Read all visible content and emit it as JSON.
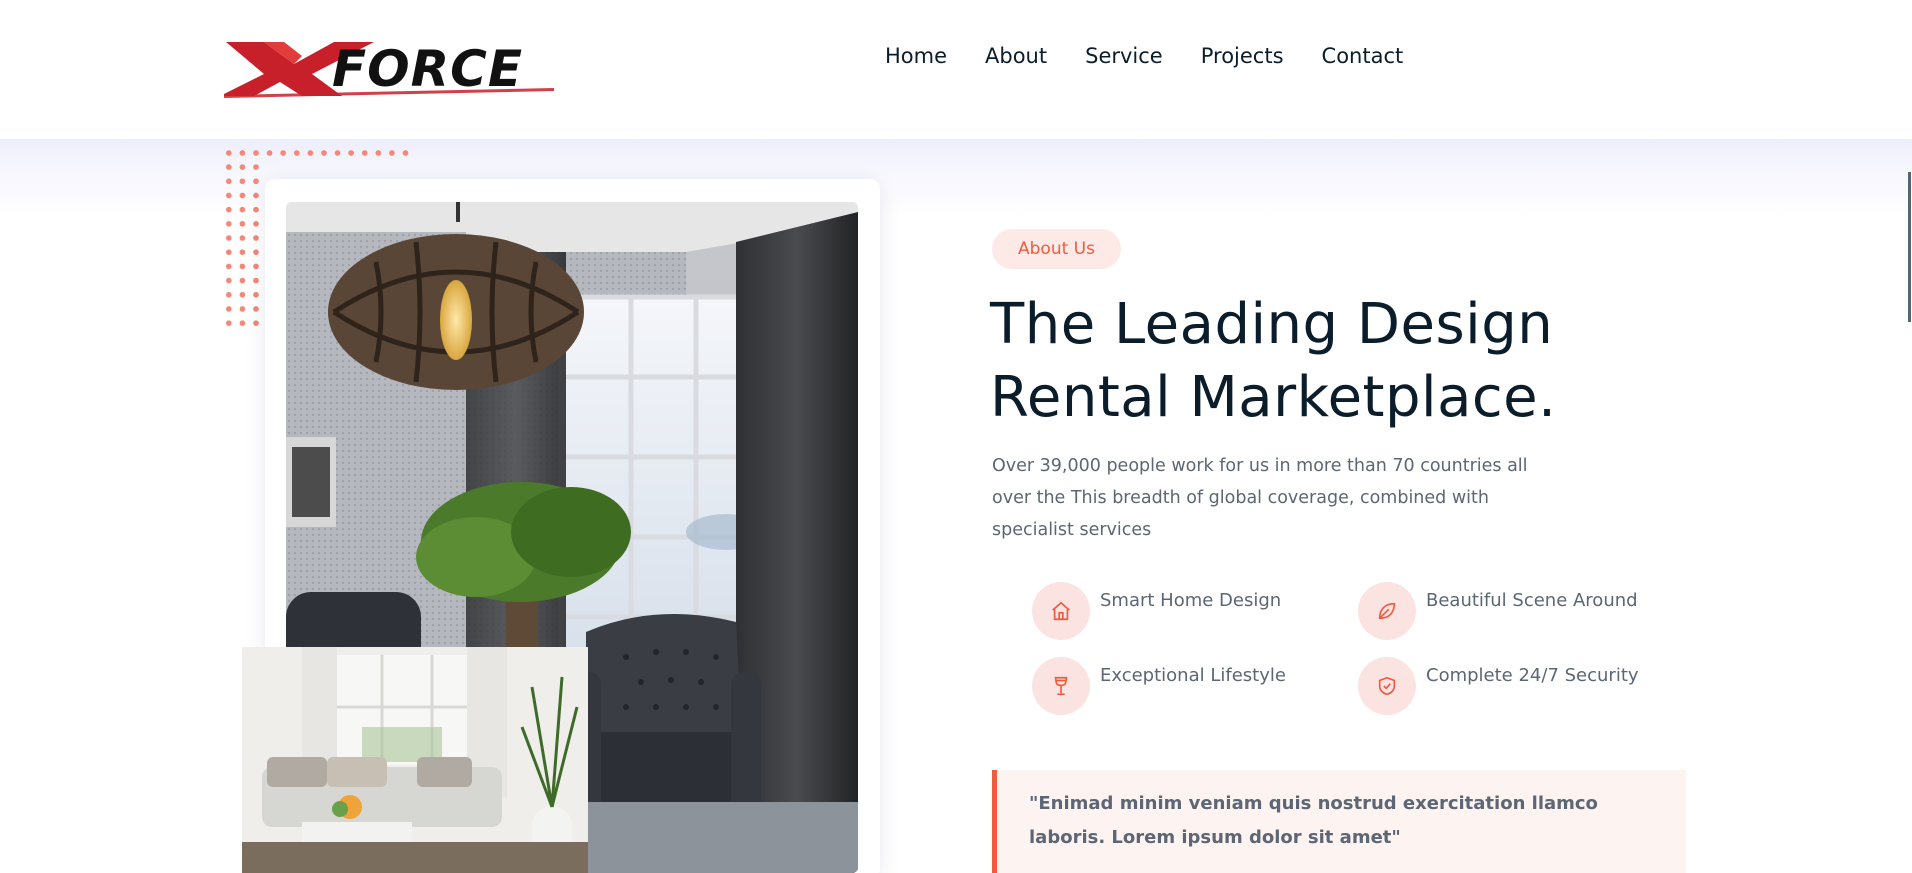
{
  "brand": {
    "logo_text_x": "X",
    "logo_text_force": "FORCE",
    "accent": "#f15a3f",
    "logo_red": "#c8202a",
    "dark": "#0b1d2a"
  },
  "nav": {
    "items": [
      "Home",
      "About",
      "Service",
      "Projects",
      "Contact"
    ]
  },
  "about": {
    "badge": "About Us",
    "title_line1": "The Leading Design",
    "title_line2": "Rental Marketplace.",
    "description": "Over 39,000 people work for us in more than 70 countries all over the This breadth of global coverage, combined with specialist services",
    "features": [
      {
        "label": "Smart Home Design",
        "icon": "home-icon"
      },
      {
        "label": "Beautiful Scene Around",
        "icon": "leaf-icon"
      },
      {
        "label": "Exceptional Lifestyle",
        "icon": "wine-glass-icon"
      },
      {
        "label": "Complete 24/7 Security",
        "icon": "shield-check-icon"
      }
    ],
    "quote": "\"Enimad minim veniam quis nostrud exercitation llamco laboris. Lorem ipsum dolor sit amet\""
  }
}
